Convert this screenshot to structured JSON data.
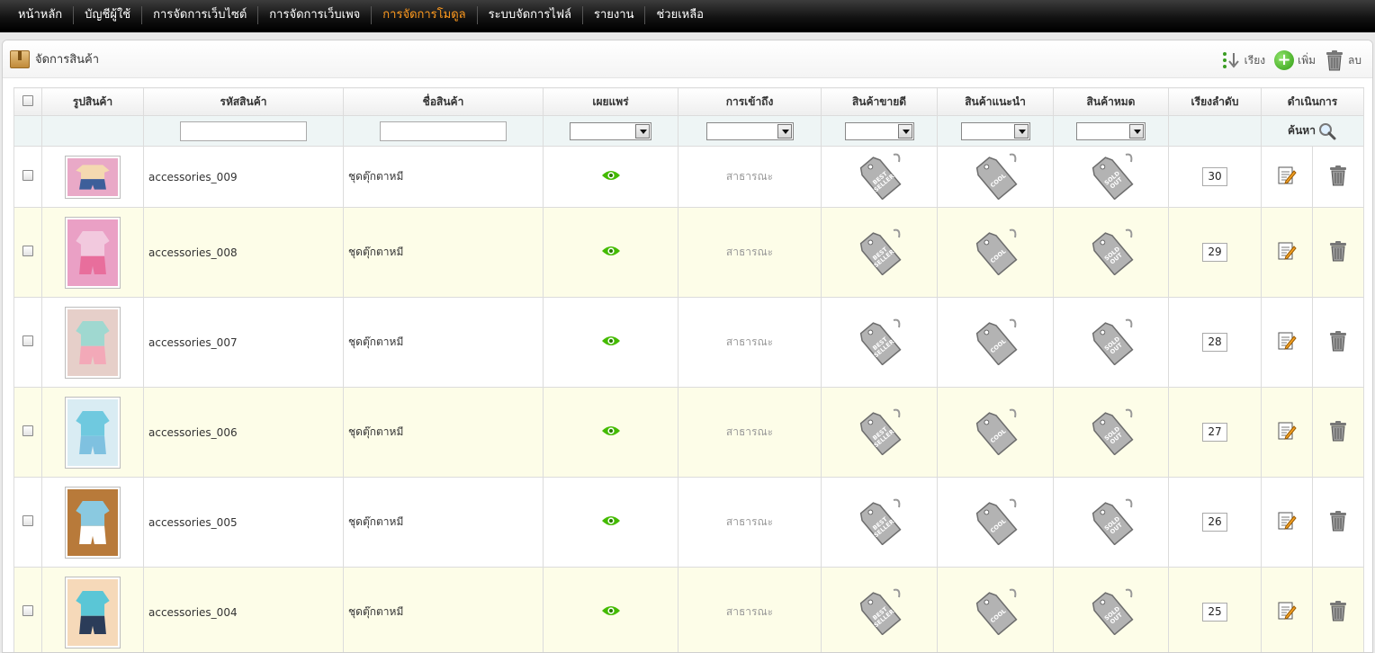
{
  "nav": [
    {
      "label": "หน้าหลัก",
      "active": false
    },
    {
      "label": "บัญชีผู้ใช้",
      "active": false
    },
    {
      "label": "การจัดการเว็บไซต์",
      "active": false
    },
    {
      "label": "การจัดการเว็บเพจ",
      "active": false
    },
    {
      "label": "การจัดการโมดูล",
      "active": true
    },
    {
      "label": "ระบบจัดการไฟล์",
      "active": false
    },
    {
      "label": "รายงาน",
      "active": false
    },
    {
      "label": "ช่วยเหลือ",
      "active": false
    }
  ],
  "panel": {
    "title": "จัดการสินค้า",
    "sort_label": "เรียง",
    "add_label": "เพิ่ม",
    "delete_label": "ลบ"
  },
  "columns": [
    "รูปสินค้า",
    "รหัสสินค้า",
    "ชื่อสินค้า",
    "เผยแพร่",
    "การเข้าถึง",
    "สินค้าขายดี",
    "สินค้าแนะนำ",
    "สินค้าหมด",
    "เรียงลำดับ",
    "ดำเนินการ"
  ],
  "search_label": "ค้นหา",
  "icons": {
    "publish": "eye-icon",
    "bestseller": "best-seller-tag-icon",
    "cool": "cool-tag-icon",
    "soldout": "sold-out-tag-icon",
    "edit": "edit-icon",
    "delete": "trash-icon"
  },
  "colors": {
    "active_nav": "#ff9a1e",
    "eye": "#44bb00",
    "alt_row": "#fdfde8"
  },
  "tags": {
    "best": [
      "BEST",
      "SELLER"
    ],
    "cool": [
      "COOL"
    ],
    "sold": [
      "SOLD",
      "OUT"
    ]
  },
  "rows": [
    {
      "code": "accessories_009",
      "name": "ชุดตุ๊กตาหมี",
      "access": "สาธารณะ",
      "order": "30"
    },
    {
      "code": "accessories_008",
      "name": "ชุดตุ๊กตาหมี",
      "access": "สาธารณะ",
      "order": "29"
    },
    {
      "code": "accessories_007",
      "name": "ชุดตุ๊กตาหมี",
      "access": "สาธารณะ",
      "order": "28"
    },
    {
      "code": "accessories_006",
      "name": "ชุดตุ๊กตาหมี",
      "access": "สาธารณะ",
      "order": "27"
    },
    {
      "code": "accessories_005",
      "name": "ชุดตุ๊กตาหมี",
      "access": "สาธารณะ",
      "order": "26"
    },
    {
      "code": "accessories_004",
      "name": "ชุดตุ๊กตาหมี",
      "access": "สาธารณะ",
      "order": "25"
    }
  ]
}
